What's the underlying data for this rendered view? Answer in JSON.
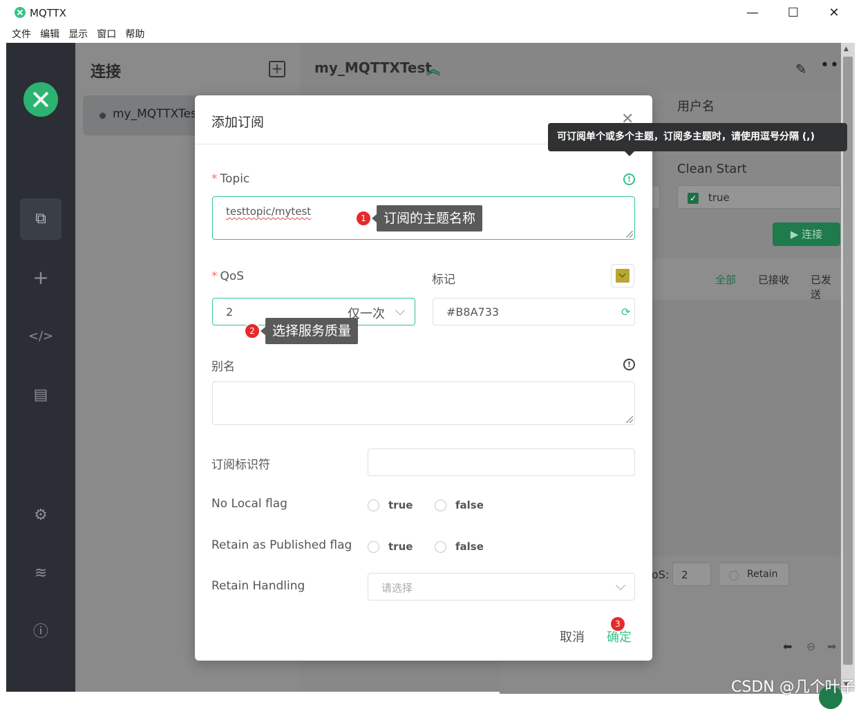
{
  "window": {
    "title": "MQTTX",
    "controls": [
      "—",
      "☐",
      "✕"
    ]
  },
  "menu": [
    "文件",
    "编辑",
    "显示",
    "窗口",
    "帮助"
  ],
  "connections": {
    "title": "连接",
    "items": [
      {
        "name": "my_MQTTXTest"
      }
    ]
  },
  "main": {
    "title": "my_MQTTXTest",
    "username_label": "用户名",
    "clean_start_label": "Clean Start",
    "clean_start_value": "true",
    "connect_button": "连接",
    "tabs": [
      "全部",
      "已接收",
      "已发送"
    ],
    "qos_label": "oS:",
    "qos_value": "2",
    "retain_label": "Retain"
  },
  "dialog": {
    "title": "添加订阅",
    "topic_label": "Topic",
    "topic_value": "testtopic/mytest",
    "qos_label": "QoS",
    "qos_value": "2",
    "qos_desc": "仅一次",
    "color_label": "标记",
    "color_value": "#B8A733",
    "alias_label": "别名",
    "subscription_id_label": "订阅标识符",
    "no_local_label": "No Local flag",
    "retain_as_published_label": "Retain as Published flag",
    "retain_handling_label": "Retain Handling",
    "retain_handling_placeholder": "请选择",
    "true_label": "true",
    "false_label": "false",
    "cancel_button": "取消",
    "confirm_button": "确定"
  },
  "tooltip": "可订阅单个或多个主题，订阅多主题时，请使用逗号分隔 (,)",
  "annotations": [
    {
      "number": "1",
      "text": "订阅的主题名称"
    },
    {
      "number": "2",
      "text": "选择服务质量"
    },
    {
      "number": "3"
    }
  ],
  "watermark": "CSDN @几个叶子",
  "colors": {
    "accent": "#34C388",
    "tag_color": "#B8A733",
    "sidebar": "#2B2F35",
    "badge": "#E52A2A"
  }
}
